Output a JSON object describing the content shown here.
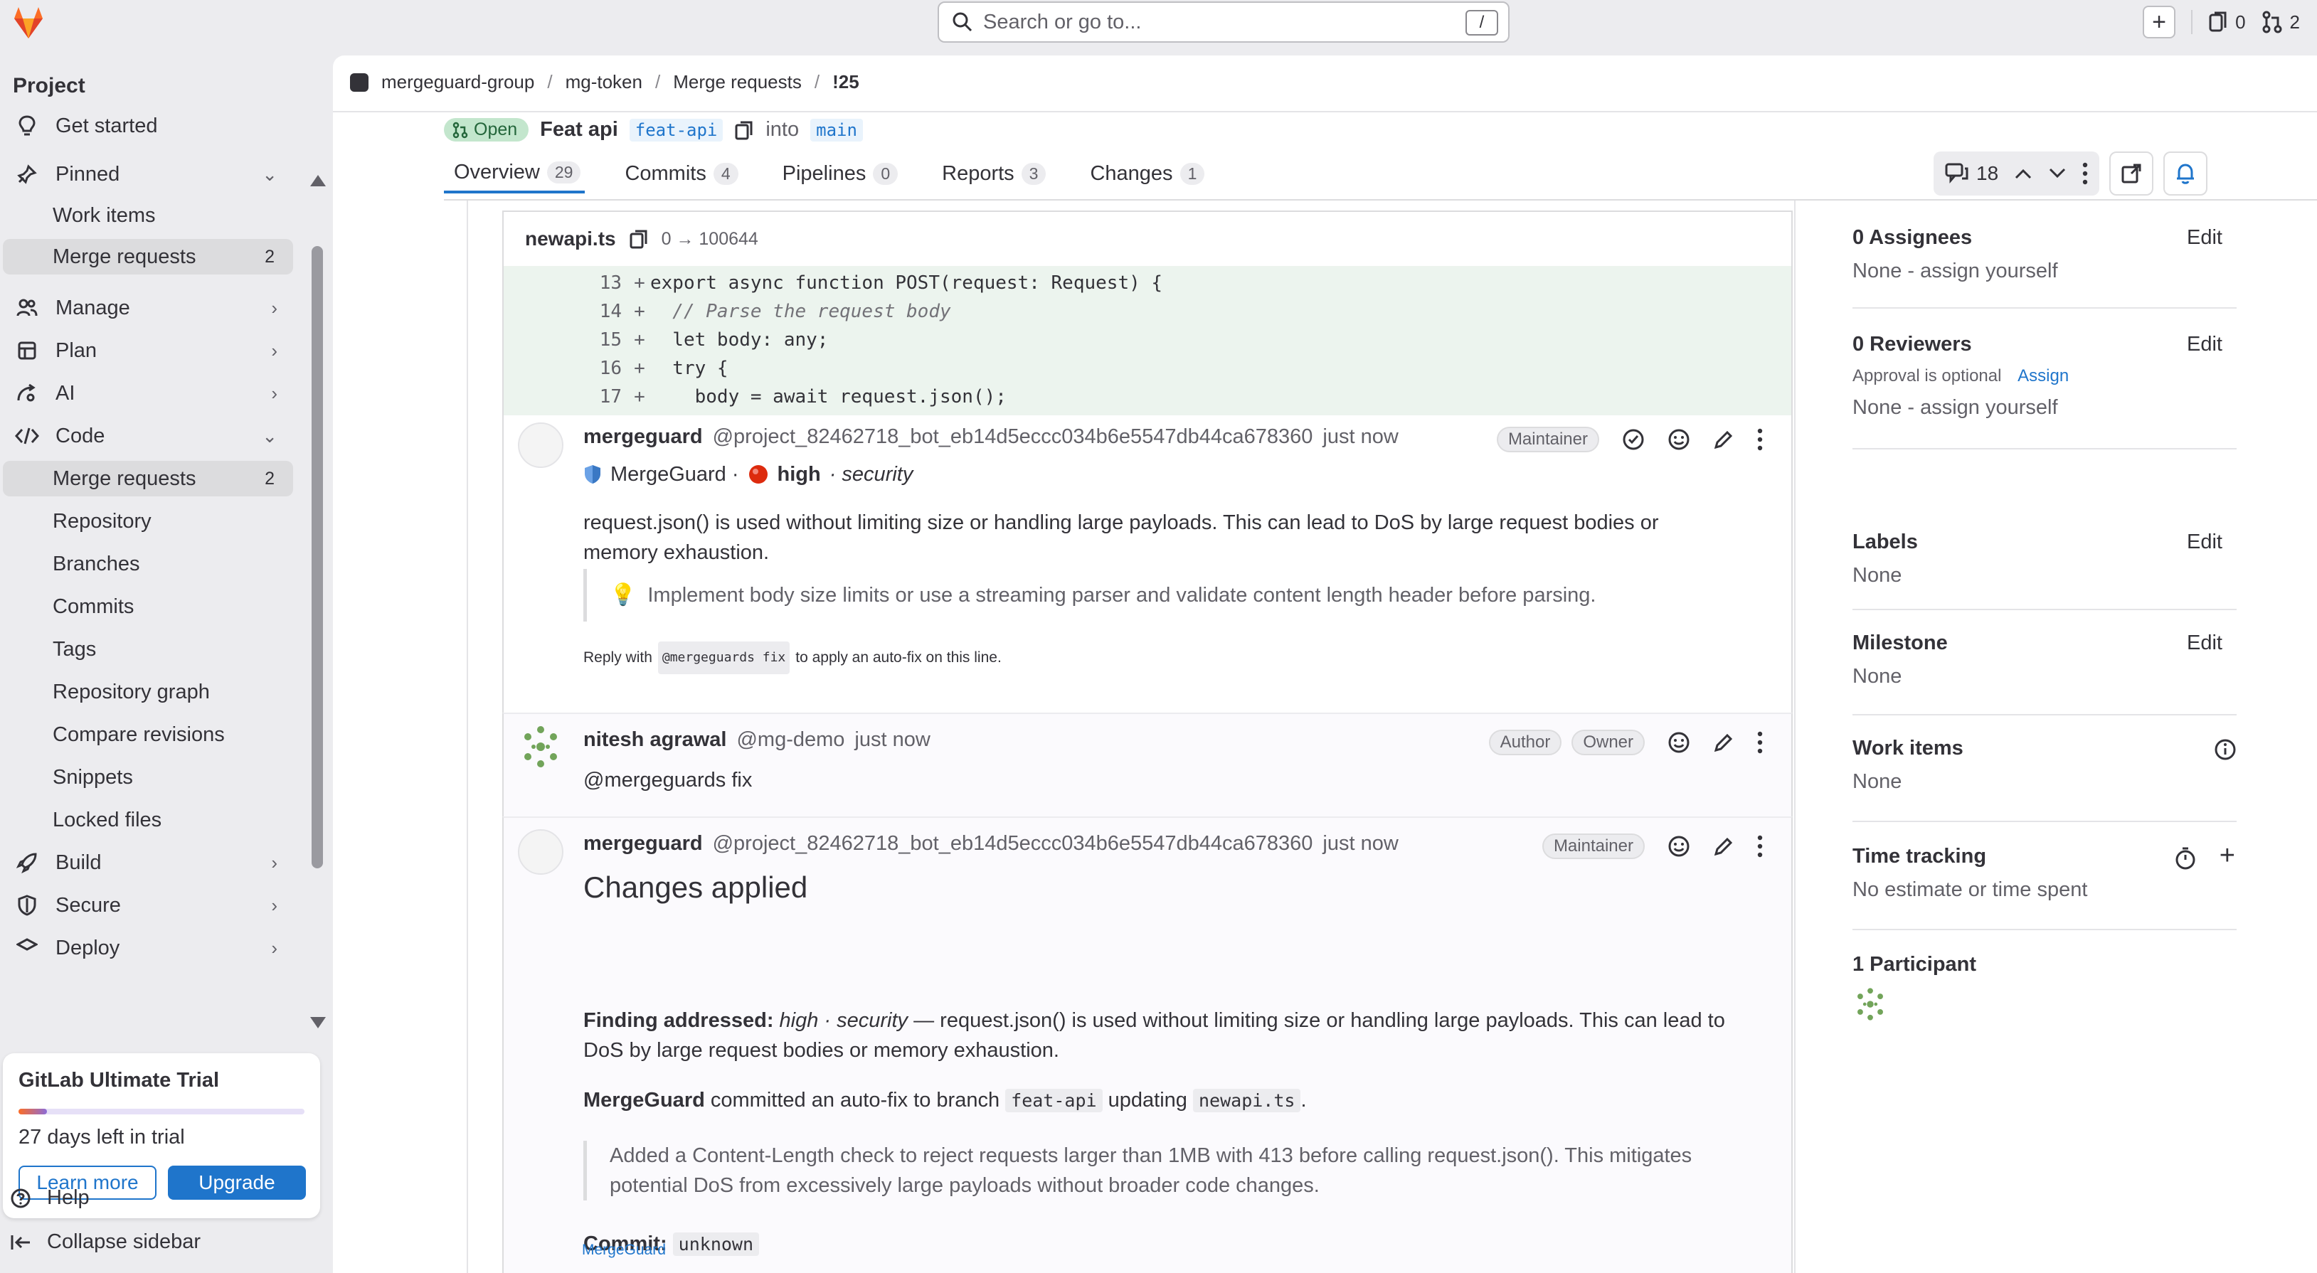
{
  "topbar": {
    "search_placeholder": "Search or go to...",
    "search_shortcut": "/",
    "issues_count": "0",
    "mr_count": "2"
  },
  "sidebar": {
    "title": "Project",
    "items": [
      {
        "label": "Get started"
      },
      {
        "label": "Pinned"
      },
      {
        "label": "Work items"
      },
      {
        "label": "Merge requests",
        "count": "2"
      },
      {
        "label": "Manage"
      },
      {
        "label": "Plan"
      },
      {
        "label": "AI"
      },
      {
        "label": "Code"
      },
      {
        "label": "Merge requests",
        "count": "2"
      },
      {
        "label": "Repository"
      },
      {
        "label": "Branches"
      },
      {
        "label": "Commits"
      },
      {
        "label": "Tags"
      },
      {
        "label": "Repository graph"
      },
      {
        "label": "Compare revisions"
      },
      {
        "label": "Snippets"
      },
      {
        "label": "Locked files"
      },
      {
        "label": "Build"
      },
      {
        "label": "Secure"
      },
      {
        "label": "Deploy"
      }
    ],
    "trial": {
      "title": "GitLab Ultimate Trial",
      "days": "27 days left in trial",
      "progress": 0.1,
      "learn_more": "Learn more",
      "upgrade": "Upgrade"
    },
    "help": "Help",
    "collapse": "Collapse sidebar"
  },
  "breadcrumb": [
    "mergeguard-group",
    "mg-token",
    "Merge requests",
    "!25"
  ],
  "mr": {
    "status": "Open",
    "title": "Feat api",
    "source_branch": "feat-api",
    "into": "into",
    "target_branch": "main"
  },
  "tabs": [
    {
      "label": "Overview",
      "count": "29"
    },
    {
      "label": "Commits",
      "count": "4"
    },
    {
      "label": "Pipelines",
      "count": "0"
    },
    {
      "label": "Reports",
      "count": "3"
    },
    {
      "label": "Changes",
      "count": "1"
    }
  ],
  "threads_count": "18",
  "diff": {
    "filename": "newapi.ts",
    "mode": "0 → 100644",
    "lines": [
      {
        "num": "13",
        "code": "export async function POST(request: Request) {"
      },
      {
        "num": "14",
        "code": "  // Parse the request body"
      },
      {
        "num": "15",
        "code": "  let body: any;"
      },
      {
        "num": "16",
        "code": "  try {"
      },
      {
        "num": "17",
        "code": "    body = await request.json();"
      }
    ]
  },
  "notes": [
    {
      "author": "mergeguard",
      "handle": "@project_82462718_bot_eb14d5eccc034b6e5547db44ca678360",
      "time": "just now",
      "role": "Maintainer",
      "meta_brand": "MergeGuard ·",
      "meta_severity": "high",
      "meta_category": "· security",
      "text": "request.json() is used without limiting size or handling large payloads. This can lead to DoS by large request bodies or memory exhaustion.",
      "suggestion": "Implement body size limits or use a streaming parser and validate content length header before parsing.",
      "reply_pre": "Reply with",
      "reply_code": "@mergeguards fix",
      "reply_post": "to apply an auto-fix on this line."
    },
    {
      "author": "nitesh agrawal",
      "handle": "@mg-demo",
      "time": "just now",
      "role1": "Author",
      "role2": "Owner",
      "text": "@mergeguards fix"
    },
    {
      "author": "mergeguard",
      "handle": "@project_82462718_bot_eb14d5eccc034b6e5547db44ca678360",
      "time": "just now",
      "role": "Maintainer",
      "heading": "Changes applied",
      "finding_label": "Finding addressed:",
      "finding_sev": "high · security",
      "finding_text": "— request.json() is used without limiting size or handling large payloads. This can lead to DoS by large request bodies or memory exhaustion.",
      "commit_brand": "MergeGuard",
      "commit_text1": "committed an auto-fix to branch",
      "commit_branch": "feat-api",
      "commit_text2": "updating",
      "commit_file": "newapi.ts",
      "commit_dot": ".",
      "quote": "Added a Content-Length check to reject requests larger than 1MB with 413 before calling request.json(). This mitigates potential DoS from excessively large payloads without broader code changes.",
      "commit_label": "Commit:",
      "commit_value": "unknown",
      "footer": "MergeGuard"
    }
  ],
  "right": {
    "assignees_title": "0 Assignees",
    "assignees_value": "None - assign yourself",
    "reviewers_title": "0 Reviewers",
    "reviewers_optional": "Approval is optional",
    "reviewers_assign": "Assign",
    "reviewers_value": "None - assign yourself",
    "labels_title": "Labels",
    "labels_value": "None",
    "milestone_title": "Milestone",
    "milestone_value": "None",
    "workitems_title": "Work items",
    "workitems_value": "None",
    "time_title": "Time tracking",
    "time_value": "No estimate or time spent",
    "participants_title": "1 Participant",
    "edit": "Edit"
  },
  "colors": {
    "accent": "#1f75cb",
    "open_bg": "#c3e6cd",
    "diff_add": "#ecf4ee"
  }
}
